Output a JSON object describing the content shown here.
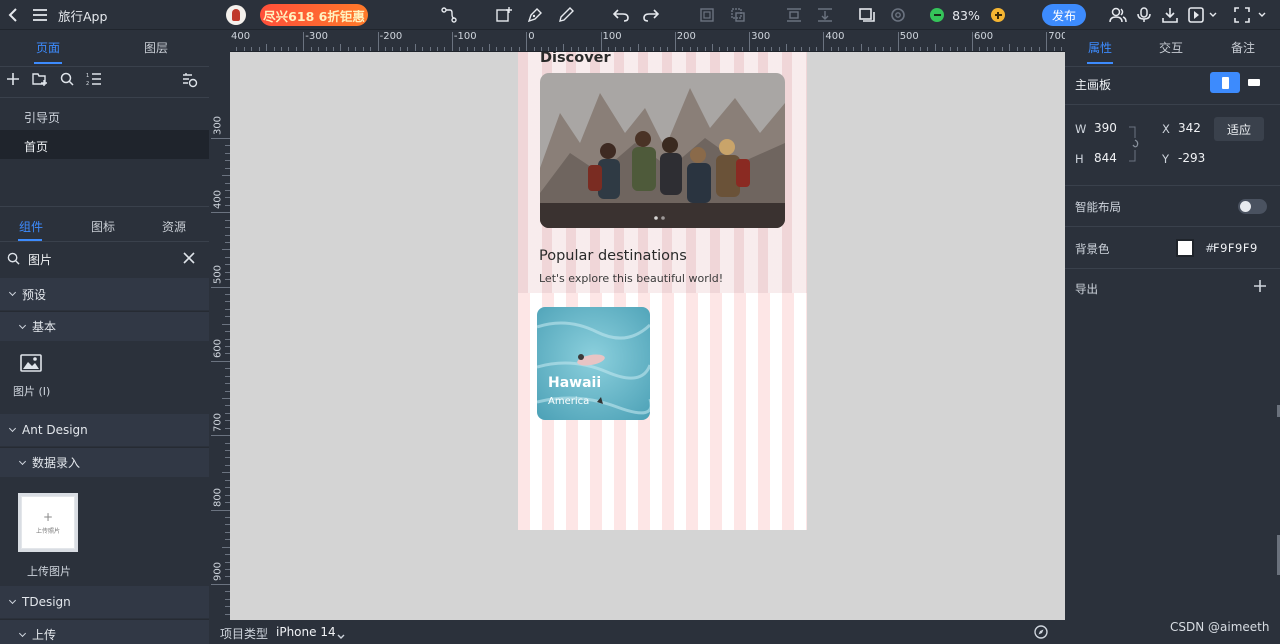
{
  "app": {
    "title": "旅行App",
    "promo": "尽兴618 6折钜惠",
    "zoom": "83%",
    "publish": "发布"
  },
  "left": {
    "tabs": [
      "页面",
      "图层"
    ],
    "pages": [
      "引导页",
      "首页"
    ],
    "comp_tabs": [
      "组件",
      "图标",
      "资源"
    ],
    "search_value": "图片",
    "sections": {
      "preset": "预设",
      "basic": "基本",
      "image_item": "图片 (I)",
      "ant": "Ant Design",
      "data_entry": "数据录入",
      "upload_inner": "上传照片",
      "upload_label": "上传图片",
      "tdesign": "TDesign",
      "upload": "上传"
    }
  },
  "ruler": {
    "h": [
      "400",
      "-300",
      "-200",
      "-100",
      "0",
      "100",
      "200",
      "300",
      "400",
      "500",
      "600",
      "700"
    ],
    "v": [
      "300",
      "400",
      "500",
      "600",
      "700",
      "800",
      "900"
    ]
  },
  "artboard": {
    "discover": "Discover",
    "popular_title": "Popular destinations",
    "popular_sub": "Let's explore this beautiful world!",
    "card_title": "Hawaii",
    "card_sub": "America"
  },
  "right": {
    "tabs": [
      "属性",
      "交互",
      "备注"
    ],
    "board_label": "主画板",
    "w_label": "W",
    "w": "390",
    "h_label": "H",
    "h": "844",
    "x_label": "X",
    "x": "342",
    "y_label": "Y",
    "y": "-293",
    "fit": "适应",
    "smart_layout": "智能布局",
    "bg_label": "背景色",
    "bg_hash": "#",
    "bg_value": "F9F9F9",
    "export": "导出"
  },
  "bottom": {
    "project_type_label": "项目类型",
    "device": "iPhone 14"
  },
  "watermark": "CSDN @aimeeth"
}
